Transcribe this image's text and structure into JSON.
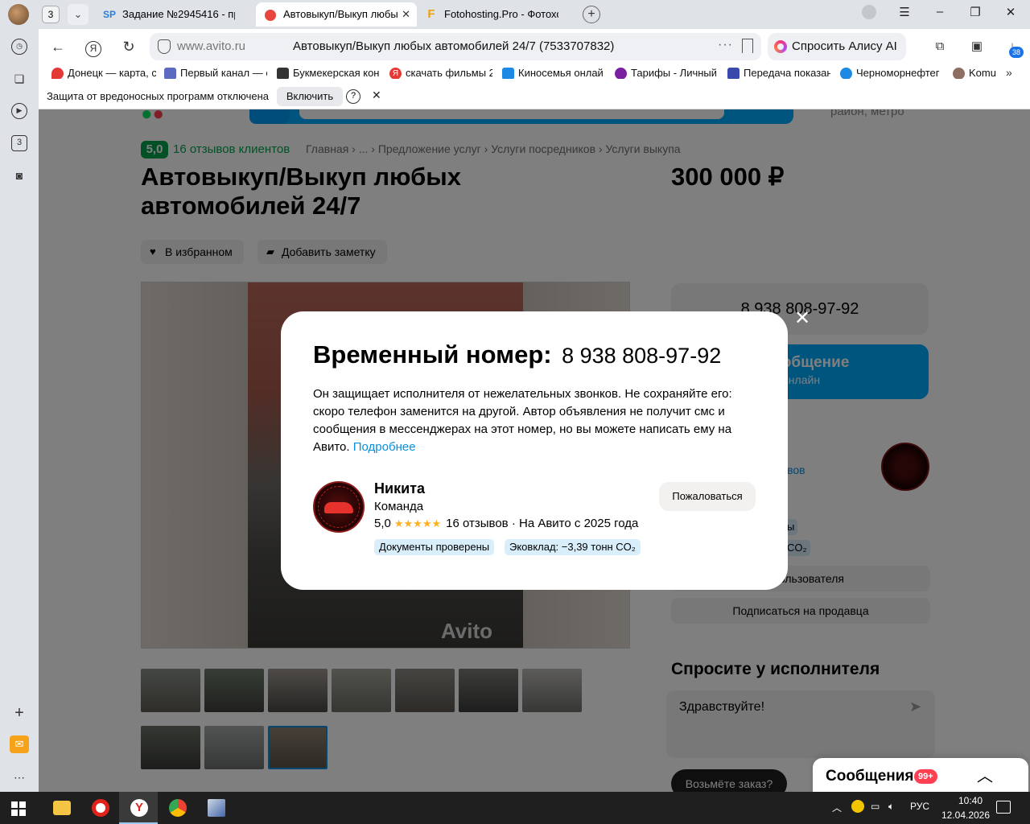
{
  "browser": {
    "tab_count": "3",
    "tabs": [
      {
        "favicon": "SP",
        "title": "Задание №2945416 - про"
      },
      {
        "favicon": "avito-icon",
        "title": "Автовыкуп/Выкуп любы"
      },
      {
        "favicon": "F",
        "title": "Fotohosting.Pro - Фотохос"
      }
    ],
    "address": {
      "domain": "www.avito.ru",
      "page_title": "Автовыкуп/Выкуп любых автомобилей 24/7 (7533707832)"
    },
    "alice_button": "Спросить Алису AI",
    "downloads_badge": "38",
    "bookmarks": [
      {
        "label": "Донецк — карта, с",
        "color": "#e53935"
      },
      {
        "label": "Первый канал — с",
        "color": "#5c6bc0"
      },
      {
        "label": "Букмекерская кон",
        "color": "#333333"
      },
      {
        "label": "скачать фильмы 2",
        "color": "#e53935"
      },
      {
        "label": "Киносемья онлай",
        "color": "#1e88e5"
      },
      {
        "label": "Тарифы - Личный",
        "color": "#7b1fa2"
      },
      {
        "label": "Передача показан",
        "color": "#3949ab"
      },
      {
        "label": "Черноморнефтег",
        "color": "#1e88e5"
      },
      {
        "label": "Komu",
        "color": "#8d6e63"
      }
    ],
    "left_bar_tab_count": "3",
    "infobar": {
      "text": "Защита от вредоносных программ отключена",
      "button": "Включить",
      "help": "?"
    }
  },
  "page": {
    "region_hint": "район, метро",
    "rating": "5,0",
    "reviews_link": "16 отзывов клиентов",
    "breadcrumb": "Главная › ... › Предложение услуг › Услуги посредников › Услуги выкупа",
    "title": "Автовыкуп/Выкуп любых автомобилей 24/7",
    "price": "300 000 ₽",
    "favorite_button": "В избранном",
    "note_button": "Добавить заметку",
    "gallery_watermark": "Avito",
    "phone": "8 938 808-97-92",
    "message_button": "ь сообщение",
    "message_status": "Онлайн",
    "seller_reviews_fragment": "ывов",
    "badge_fragment_1": "ы",
    "badge_fragment_2": "CO₂",
    "seller_buttons": [
      "ия пользователя",
      "Подписаться на продавца"
    ],
    "ask_title": "Спросите у исполнителя",
    "ask_input_value": "Здравствуйте!",
    "take_order_button": "Возьмёте заказ?",
    "messages_widget": {
      "title": "Сообщения",
      "badge": "99+"
    }
  },
  "modal": {
    "heading_label": "Временный номер:",
    "heading_number": "8 938 808-97-92",
    "description": "Он защищает исполнителя от нежелательных звонков. Не сохраняйте его: скоро телефон заменится на другой. Автор объявления не получит смс и сообщения в мессенджерах на этот номер, но вы можете написать ему на Авито.",
    "more_link": "Подробнее",
    "seller": {
      "name": "Никита",
      "role": "Команда",
      "rating": "5,0",
      "stars": "★★★★★",
      "reviews": "16 отзывов",
      "since": "· На Авито с 2025 года"
    },
    "badges": [
      "Документы проверены",
      "Эковклад: −3,39 тонн CO₂"
    ],
    "complain_button": "Пожаловаться"
  },
  "taskbar": {
    "language": "РУС",
    "time": "10:40",
    "date": "12.04.2026"
  }
}
